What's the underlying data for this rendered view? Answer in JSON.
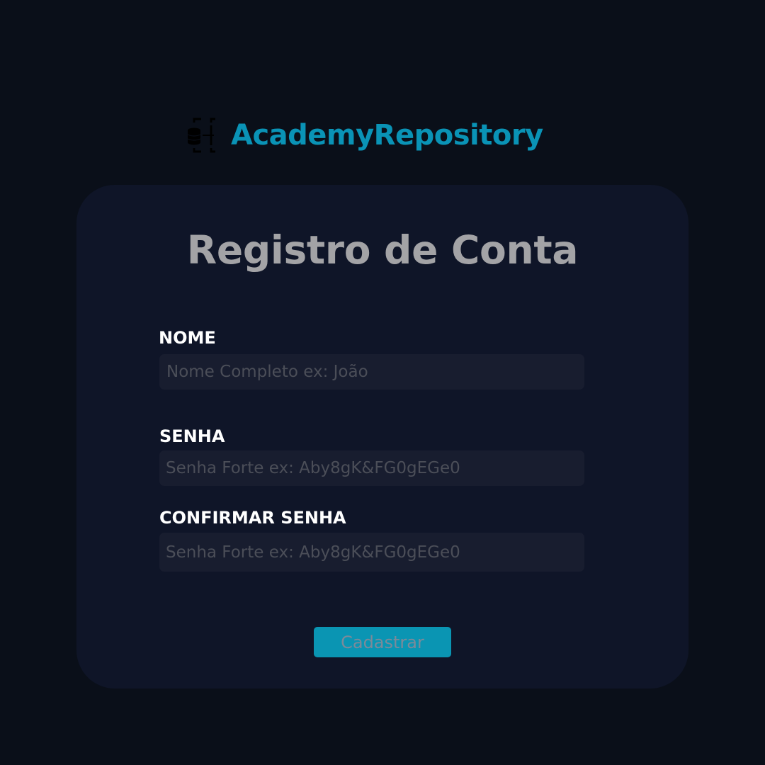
{
  "brand": {
    "icon": "database-network-icon",
    "name": "AcademyRepository"
  },
  "form": {
    "title": "Registro de Conta",
    "fields": [
      {
        "label": "NOME",
        "placeholder": "Nome Completo ex: João",
        "value": ""
      },
      {
        "label": "SENHA",
        "placeholder": "Senha Forte ex: Aby8gK&FG0gEGe0",
        "value": ""
      },
      {
        "label": "CONFIRMAR SENHA",
        "placeholder": "Senha Forte ex: Aby8gK&FG0gEGe0",
        "value": ""
      }
    ],
    "submit_label": "Cadastrar"
  },
  "colors": {
    "page_background": "#0a0f19",
    "card_background": "#0f1528",
    "input_background": "#181d2f",
    "accent": "#0a95b3",
    "brand_text": "#0a93b6",
    "title_text": "#a3a3a6"
  }
}
